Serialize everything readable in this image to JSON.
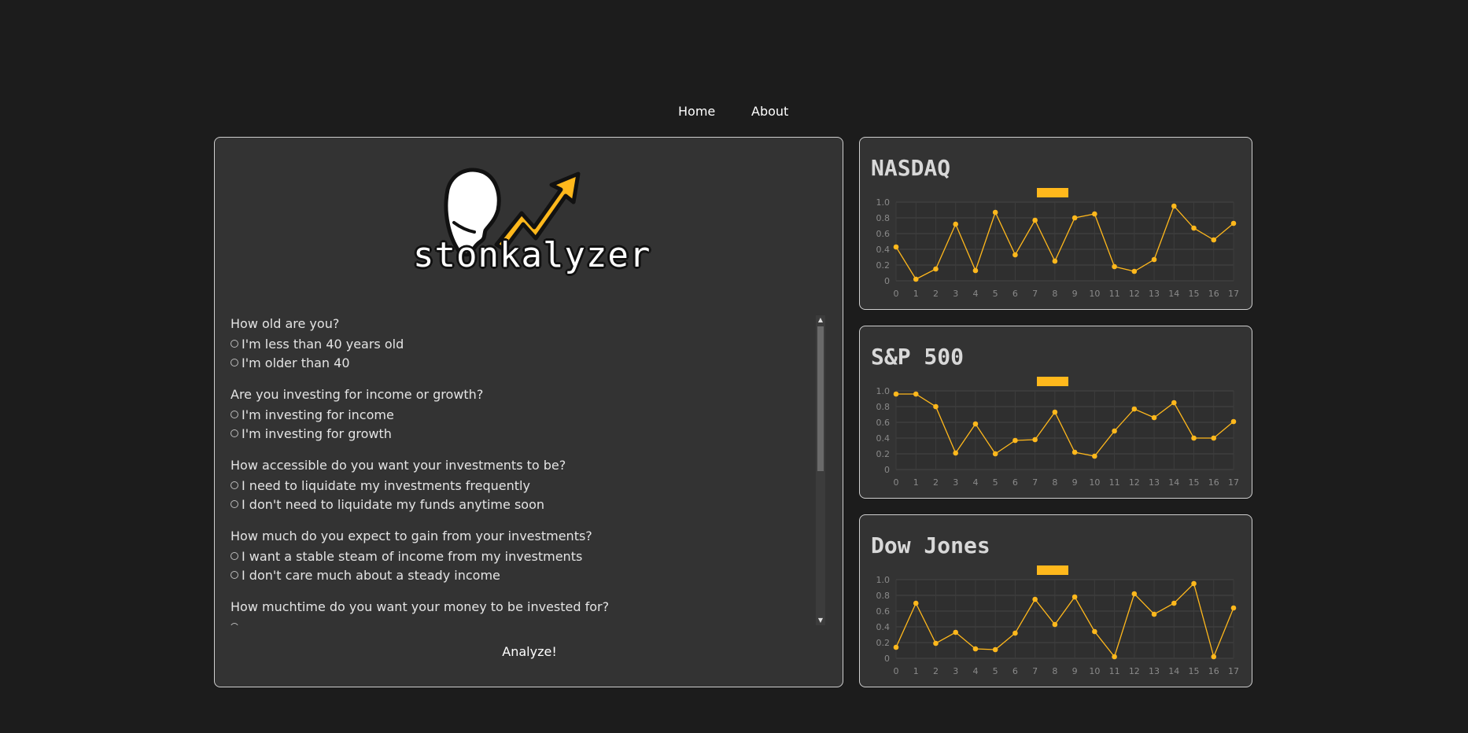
{
  "nav": {
    "home": "Home",
    "about": "About"
  },
  "brand": {
    "name": "stonkalyzer"
  },
  "colors": {
    "accent": "#ffb81c",
    "panel": "#333333",
    "background": "#1c1c1c"
  },
  "questions": [
    {
      "title": "How old are you?",
      "options": [
        "I'm less than 40 years old",
        "I'm older than 40"
      ]
    },
    {
      "title": "Are you investing for income or growth?",
      "options": [
        "I'm investing for income",
        "I'm investing for growth"
      ]
    },
    {
      "title": "How accessible do you want your investments to be?",
      "options": [
        "I need to liquidate my investments frequently",
        "I don't need to liquidate my funds anytime soon"
      ]
    },
    {
      "title": "How much do you expect to gain from your investments?",
      "options": [
        "I want a stable steam of income from my investments",
        "I don't care much about a steady income"
      ]
    },
    {
      "title": "How muchtime do you want your money to be invested for?",
      "options": []
    }
  ],
  "analyze_button": "Analyze!",
  "chart_data": [
    {
      "type": "line",
      "title": "NASDAQ",
      "x": [
        0,
        1,
        2,
        3,
        4,
        5,
        6,
        7,
        8,
        9,
        10,
        11,
        12,
        13,
        14,
        15,
        16,
        17
      ],
      "series": [
        {
          "values": [
            0.43,
            0.02,
            0.15,
            0.72,
            0.13,
            0.87,
            0.33,
            0.77,
            0.25,
            0.8,
            0.85,
            0.18,
            0.12,
            0.27,
            0.95,
            0.67,
            0.52,
            0.73
          ],
          "color": "#ffb81c"
        }
      ],
      "ylim": [
        0,
        1.0
      ],
      "yticks": [
        "0",
        "0.2",
        "0.4",
        "0.6",
        "0.8",
        "1.0"
      ],
      "grid": true
    },
    {
      "type": "line",
      "title": "S&P 500",
      "x": [
        0,
        1,
        2,
        3,
        4,
        5,
        6,
        7,
        8,
        9,
        10,
        11,
        12,
        13,
        14,
        15,
        16,
        17
      ],
      "series": [
        {
          "values": [
            0.96,
            0.96,
            0.8,
            0.21,
            0.58,
            0.2,
            0.37,
            0.38,
            0.73,
            0.22,
            0.17,
            0.49,
            0.77,
            0.66,
            0.85,
            0.4,
            0.4,
            0.61
          ],
          "color": "#ffb81c"
        }
      ],
      "ylim": [
        0,
        1.0
      ],
      "yticks": [
        "0",
        "0.2",
        "0.4",
        "0.6",
        "0.8",
        "1.0"
      ],
      "grid": true
    },
    {
      "type": "line",
      "title": "Dow Jones",
      "x": [
        0,
        1,
        2,
        3,
        4,
        5,
        6,
        7,
        8,
        9,
        10,
        11,
        12,
        13,
        14,
        15,
        16,
        17
      ],
      "series": [
        {
          "values": [
            0.14,
            0.7,
            0.19,
            0.33,
            0.12,
            0.11,
            0.32,
            0.75,
            0.43,
            0.78,
            0.34,
            0.02,
            0.82,
            0.56,
            0.7,
            0.95,
            0.02,
            0.64
          ],
          "color": "#ffb81c"
        }
      ],
      "ylim": [
        0,
        1.0
      ],
      "yticks": [
        "0",
        "0.2",
        "0.4",
        "0.6",
        "0.8",
        "1.0"
      ],
      "grid": true
    }
  ]
}
